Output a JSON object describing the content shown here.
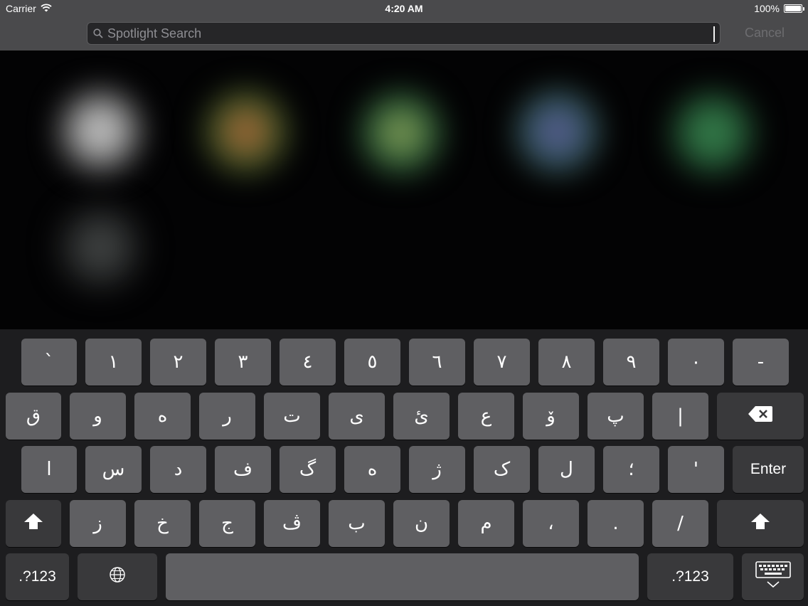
{
  "status_bar": {
    "carrier": "Carrier",
    "time": "4:20 AM",
    "battery": "100%"
  },
  "search": {
    "placeholder": "Spotlight Search",
    "value": "",
    "cancel_label": "Cancel"
  },
  "keyboard": {
    "row1": [
      "`",
      "١",
      "٢",
      "٣",
      "٤",
      "٥",
      "٦",
      "٧",
      "٨",
      "٩",
      "٠",
      "-"
    ],
    "row2": [
      "ق",
      "و",
      "ه",
      "ر",
      "ت",
      "ى",
      "ئ",
      "ع",
      "ۆ",
      "پ",
      "|"
    ],
    "row3": [
      "ا",
      "س",
      "د",
      "ف",
      "گ",
      "ه",
      "ژ",
      "ک",
      "ل",
      "؛",
      "'"
    ],
    "row4": [
      "ز",
      "خ",
      "ج",
      "ڤ",
      "ب",
      "ن",
      "م",
      "،",
      ".",
      "/"
    ],
    "enter_label": "Enter",
    "numbers_label": ".?123"
  },
  "icons": [
    "wifi-icon",
    "battery-icon",
    "search-icon",
    "backspace-icon",
    "shift-icon",
    "globe-icon",
    "keyboard-dismiss-icon"
  ]
}
